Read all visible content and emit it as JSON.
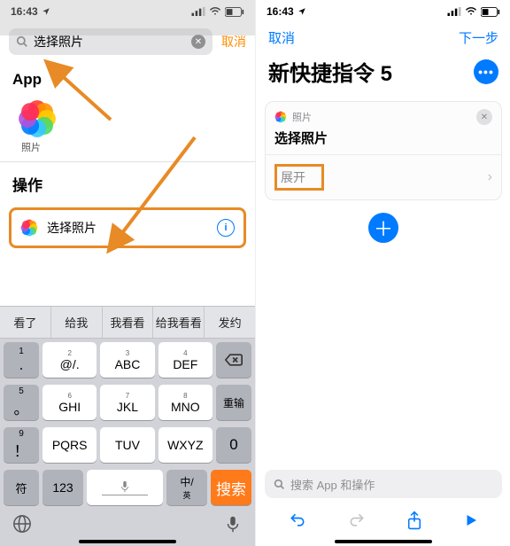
{
  "left": {
    "status": {
      "time": "16:43",
      "loc_icon": "location-icon"
    },
    "search": {
      "value": "选择照片",
      "cancel": "取消"
    },
    "app_header": "App",
    "photos_label": "照片",
    "ops_header": "操作",
    "action": {
      "label": "选择照片"
    },
    "suggestions": [
      "看了",
      "给我",
      "我看看",
      "给我看看",
      "发约"
    ],
    "keys": {
      "r1": [
        "1 .",
        "@/. 2",
        "ABC 3",
        "DEF 4"
      ],
      "r2": [
        "。5",
        "GHI 6",
        "JKL 7",
        "MNO 8",
        "重输"
      ],
      "r3": [
        "！9",
        "PQRS",
        "TUV",
        "WXYZ",
        "0"
      ],
      "r4": [
        "符",
        "123",
        "space",
        "中/英",
        "搜索"
      ]
    }
  },
  "right": {
    "status": {
      "time": "16:43"
    },
    "nav": {
      "cancel": "取消",
      "next": "下一步"
    },
    "title": "新快捷指令 5",
    "card": {
      "app": "照片",
      "title": "选择照片",
      "expand": "展开"
    },
    "bottom_search": "搜索 App 和操作"
  }
}
